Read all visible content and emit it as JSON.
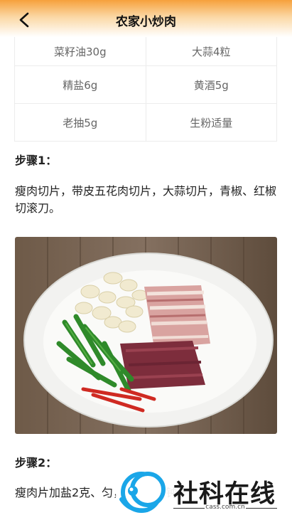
{
  "header": {
    "title": "农家小炒肉"
  },
  "ingredients": [
    [
      "菜籽油30g",
      "大蒜4粒"
    ],
    [
      "精盐6g",
      "黄酒5g"
    ],
    [
      "老抽5g",
      "生粉适量"
    ]
  ],
  "steps": [
    {
      "title": "步骤1：",
      "text": "瘦肉切片，带皮五花肉切片，大蒜切片，青椒、红椒切滚刀。"
    },
    {
      "title": "步骤2：",
      "text": "瘦肉片加盐2克、料酒，抓匀，腌制5分钟。",
      "visible_text": "瘦肉片加盐2克、匀，腌制5分钟。"
    }
  ],
  "watermark": {
    "brand": "社科在线",
    "url": "cass.com.cn"
  },
  "colors": {
    "header_accent": "#f6a13c",
    "watermark_blue": "#1aa6e8"
  }
}
